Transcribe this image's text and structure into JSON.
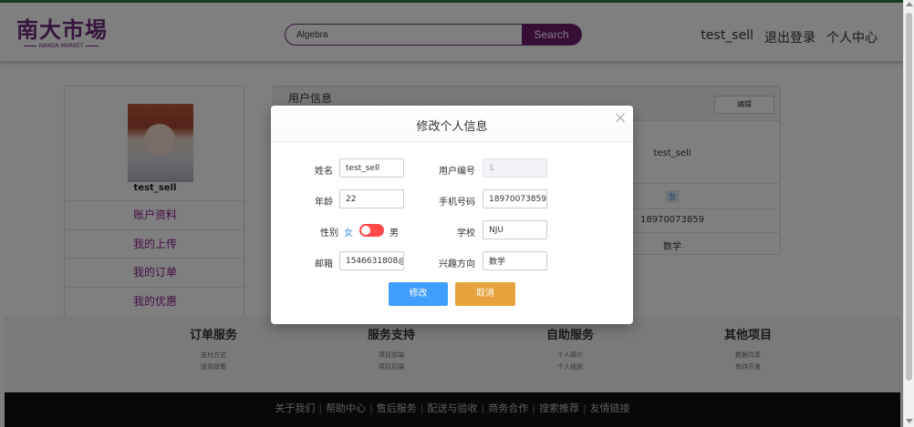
{
  "header": {
    "logo_text": "南大市埸",
    "logo_sub": "NANDA MARKET",
    "search_value": "Algebra",
    "search_button": "Search",
    "nav": [
      "test_sell",
      "退出登录",
      "个人中心"
    ]
  },
  "sidebar": {
    "username": "test_sell",
    "menu": [
      "账户资料",
      "我的上传",
      "我的订单",
      "我的优惠"
    ]
  },
  "info_panel": {
    "title": "用户信息",
    "edit_button": "编辑",
    "username": "test_sell",
    "gender": "女",
    "phone": "18970073859",
    "interest": "数学"
  },
  "footer": {
    "columns": [
      {
        "title": "订单服务",
        "links": [
          "支付方式",
          "送货政策"
        ]
      },
      {
        "title": "服务支持",
        "links": [
          "项目前端",
          "项目后端"
        ]
      },
      {
        "title": "自助服务",
        "links": [
          "个人简介",
          "个人规则"
        ]
      },
      {
        "title": "其他项目",
        "links": [
          "数据共享",
          "有待开发"
        ]
      }
    ],
    "bottom_links": [
      "关于我们",
      "帮助中心",
      "售后服务",
      "配送与验收",
      "商务合作",
      "搜索推荐",
      "友情链接"
    ]
  },
  "modal": {
    "title": "修改个人信息",
    "close_glyph": "×",
    "fields": {
      "name_label": "姓名",
      "name_value": "test_sell",
      "userid_label": "用户编号",
      "userid_value": "1",
      "age_label": "年龄",
      "age_value": "22",
      "phone_label": "手机号码",
      "phone_value": "18970073859",
      "gender_label": "性别",
      "gender_female": "女",
      "gender_male": "男",
      "school_label": "学校",
      "school_value": "NJU",
      "email_label": "邮箱",
      "email_value": "1546631808@",
      "interest_label": "兴趣方向",
      "interest_value": "数学"
    },
    "modify_button": "修改",
    "cancel_button": "取消"
  },
  "colors": {
    "brand": "#6b2a78",
    "primary": "#409eff",
    "warning": "#e6a23c",
    "toggle": "#ff4949"
  }
}
